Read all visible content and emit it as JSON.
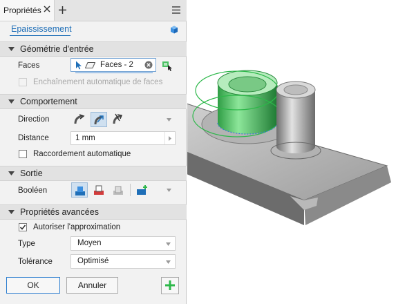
{
  "window": {
    "tab_title": "Propriétés"
  },
  "feature": {
    "name": "Epaississement"
  },
  "sections": {
    "input": "Géométrie d'entrée",
    "behavior": "Comportement",
    "output": "Sortie",
    "advanced": "Propriétés avancées"
  },
  "input_geometry": {
    "faces_label": "Faces",
    "faces_value": "Faces - 2",
    "chain_faces_label": "Enchaînement automatique de faces",
    "chain_faces_checked": false,
    "chain_faces_enabled": false
  },
  "behavior": {
    "direction_label": "Direction",
    "direction_selected": "symmetric",
    "distance_label": "Distance",
    "distance_value": "1 mm",
    "auto_blend_label": "Raccordement automatique",
    "auto_blend_checked": false
  },
  "output": {
    "boolean_label": "Booléen",
    "boolean_selected": "join"
  },
  "advanced": {
    "approx_label": "Autoriser l'approximation",
    "approx_checked": true,
    "type_label": "Type",
    "type_value": "Moyen",
    "tolerance_label": "Tolérance",
    "tolerance_value": "Optimisé"
  },
  "buttons": {
    "ok": "OK",
    "cancel": "Annuler"
  },
  "colors": {
    "accent": "#1f6fb8",
    "selection_green": "#2db84a",
    "model_gray": "#8c8c8c"
  }
}
